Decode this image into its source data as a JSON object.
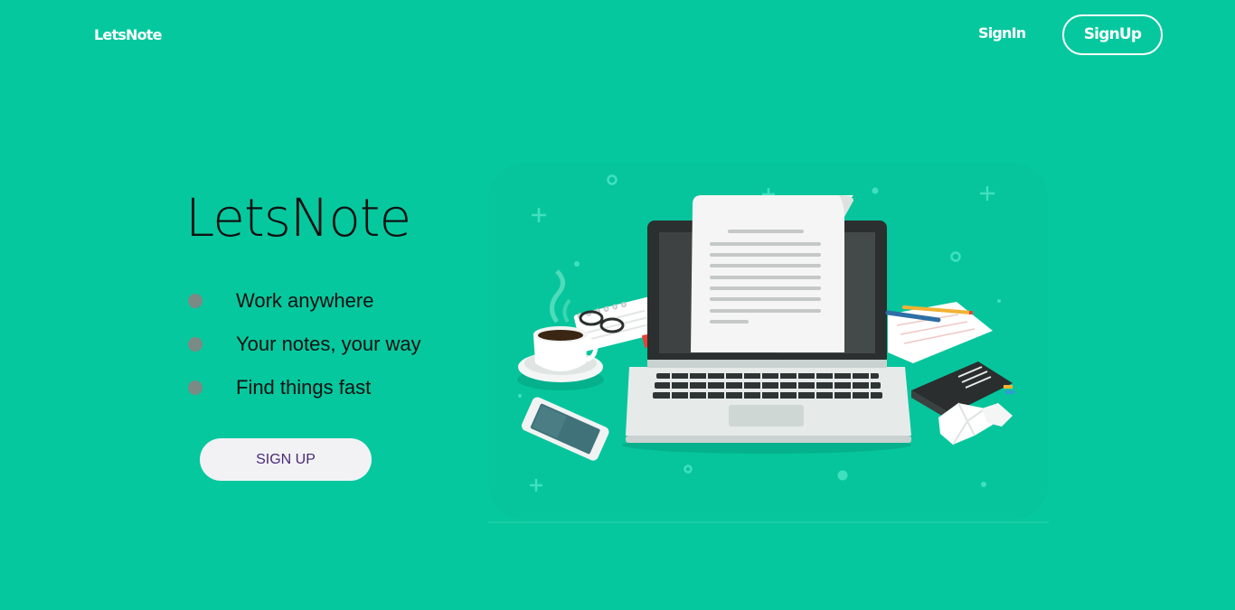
{
  "header": {
    "brand": "LetsNote",
    "signin_label": "SignIn",
    "signup_label": "SignUp"
  },
  "hero": {
    "title": "LetsNote",
    "features": [
      "Work anywhere",
      "Your notes, your way",
      "Find things fast"
    ],
    "cta_label": "SIGN UP"
  },
  "colors": {
    "background": "#06c89e",
    "cta_text": "#4a2a78",
    "bullet": "#7a8a84"
  }
}
